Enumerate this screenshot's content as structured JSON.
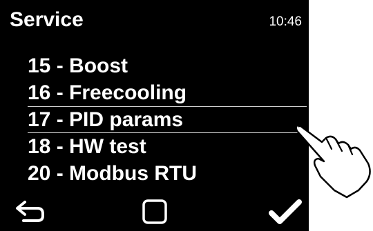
{
  "header": {
    "title": "Service",
    "time": "10:46"
  },
  "menu": {
    "items": [
      {
        "label": "15 - Boost"
      },
      {
        "label": "16 - Freecooling"
      },
      {
        "label": "17 - PID params"
      },
      {
        "label": "18 - HW test"
      },
      {
        "label": "20 - Modbus RTU"
      }
    ],
    "selected_index": 2
  },
  "bottom_bar": {
    "icons": [
      "back-arrow-icon",
      "home-square-icon",
      "checkmark-icon"
    ]
  },
  "colors": {
    "screen_background": "#000000",
    "text": "#ffffff",
    "selection_line": "#cfcfcf"
  }
}
